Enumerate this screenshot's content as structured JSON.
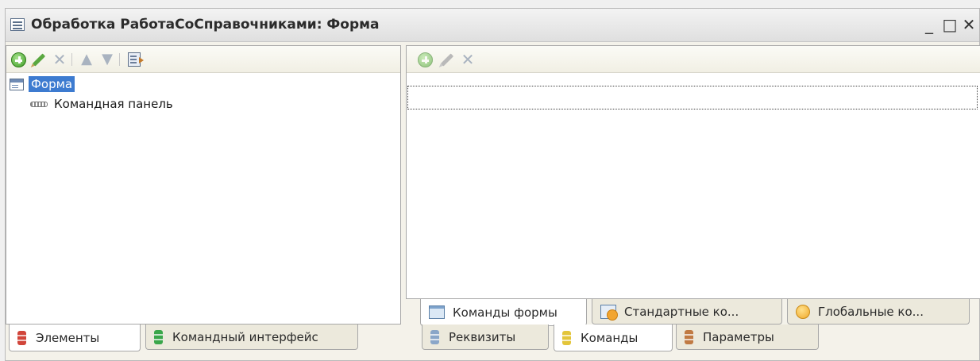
{
  "window": {
    "title": "Обработка РаботаСоСправочниками: Форма",
    "minimize": "_",
    "maximize": "□",
    "close": "✕"
  },
  "left_panel": {
    "tree": [
      {
        "label": "Форма",
        "icon": "form-icon",
        "selected": true
      },
      {
        "label": "Командная панель",
        "icon": "command-panel-icon",
        "selected": false
      }
    ],
    "tabs": [
      {
        "label": "Элементы",
        "icon": "db-red-icon",
        "active": true
      },
      {
        "label": "Командный интерфейс",
        "icon": "db-green-icon",
        "active": false
      }
    ]
  },
  "right_panel": {
    "inner_tabs": [
      {
        "label": "Команды формы",
        "icon": "window-icon",
        "active": true
      },
      {
        "label": "Стандартные ко...",
        "icon": "standard-commands-icon",
        "active": false
      },
      {
        "label": "Глобальные ко...",
        "icon": "global-commands-icon",
        "active": false
      }
    ],
    "tabs": [
      {
        "label": "Реквизиты",
        "icon": "db-blue-icon",
        "active": false
      },
      {
        "label": "Команды",
        "icon": "db-yellow-icon",
        "active": true
      },
      {
        "label": "Параметры",
        "icon": "db-brown-icon",
        "active": false
      }
    ]
  }
}
